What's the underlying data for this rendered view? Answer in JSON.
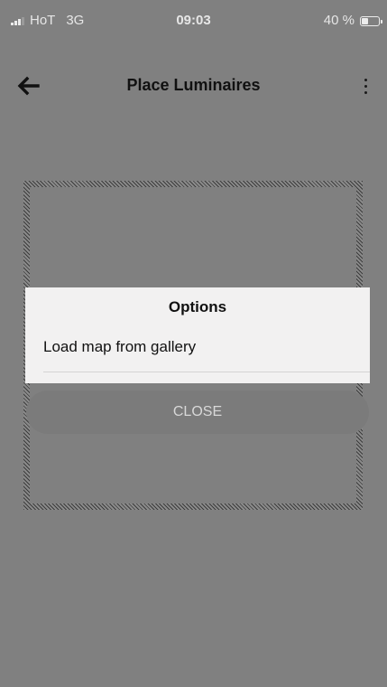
{
  "status_bar": {
    "carrier": "HoT",
    "network": "3G",
    "time": "09:03",
    "battery_label": "40 %",
    "battery_level": 0.4
  },
  "app_bar": {
    "title": "Place Luminaires",
    "back_icon": "back-arrow-icon",
    "menu_icon": "more-vertical-icon"
  },
  "dialog": {
    "title": "Options",
    "options": [
      {
        "label": "Load map from gallery"
      }
    ],
    "close_label": "CLOSE"
  },
  "colors": {
    "background_dim": "#808080",
    "dialog_background": "#f2f1f1",
    "text_dark": "#111111"
  }
}
